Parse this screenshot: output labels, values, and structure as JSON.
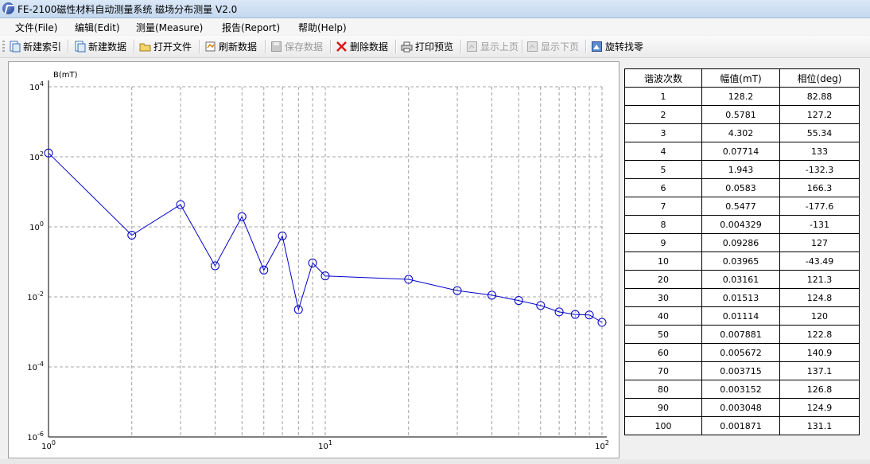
{
  "window": {
    "title": "FE-2100磁性材料自动测量系统 磁场分布测量 V2.0"
  },
  "menu": [
    "文件(File)",
    "编辑(Edit)",
    "测量(Measure)",
    "报告(Report)",
    "帮助(Help)"
  ],
  "toolbar": [
    {
      "label": "新建索引",
      "icon": "new-index-icon",
      "enabled": true
    },
    {
      "label": "新建数据",
      "icon": "new-data-icon",
      "enabled": true
    },
    {
      "label": "打开文件",
      "icon": "open-folder-icon",
      "enabled": true
    },
    {
      "label": "刷新数据",
      "icon": "refresh-icon",
      "enabled": true
    },
    {
      "label": "保存数据",
      "icon": "save-disk-icon",
      "enabled": false
    },
    {
      "label": "删除数据",
      "icon": "delete-x-icon",
      "enabled": true
    },
    {
      "label": "打印预览",
      "icon": "print-preview-icon",
      "enabled": true
    },
    {
      "label": "显示上页",
      "icon": "prev-page-icon",
      "enabled": false
    },
    {
      "label": "显示下页",
      "icon": "next-page-icon",
      "enabled": false
    },
    {
      "label": "旋转找零",
      "icon": "rotate-zero-icon",
      "enabled": true
    }
  ],
  "chart_data": {
    "type": "line",
    "ylabel": "B(mT)",
    "xscale": "log",
    "yscale": "log",
    "xlim": [
      1,
      100
    ],
    "ylim": [
      1e-06,
      10000
    ],
    "x_ticks": [
      "10^0",
      "10^1",
      "10^2"
    ],
    "y_ticks": [
      "10^4",
      "10^2",
      "10^0",
      "10^-2",
      "10^-4",
      "10^-6"
    ],
    "grid": true,
    "marker": "circle",
    "color": "#0000cc",
    "x": [
      1,
      2,
      3,
      4,
      5,
      6,
      7,
      8,
      9,
      10,
      20,
      30,
      40,
      50,
      60,
      70,
      80,
      90,
      100
    ],
    "values": [
      128.2,
      0.5781,
      4.302,
      0.07714,
      1.943,
      0.0583,
      0.5477,
      0.004329,
      0.09286,
      0.03965,
      0.03161,
      0.01513,
      0.01114,
      0.007881,
      0.005672,
      0.003715,
      0.003152,
      0.003048,
      0.001871
    ]
  },
  "table": {
    "headers": [
      "谐波次数",
      "幅值(mT)",
      "相位(deg)"
    ],
    "rows": [
      [
        "1",
        "128.2",
        "82.88"
      ],
      [
        "2",
        "0.5781",
        "127.2"
      ],
      [
        "3",
        "4.302",
        "55.34"
      ],
      [
        "4",
        "0.07714",
        "133"
      ],
      [
        "5",
        "1.943",
        "-132.3"
      ],
      [
        "6",
        "0.0583",
        "166.3"
      ],
      [
        "7",
        "0.5477",
        "-177.6"
      ],
      [
        "8",
        "0.004329",
        "-131"
      ],
      [
        "9",
        "0.09286",
        "127"
      ],
      [
        "10",
        "0.03965",
        "-43.49"
      ],
      [
        "20",
        "0.03161",
        "121.3"
      ],
      [
        "30",
        "0.01513",
        "124.8"
      ],
      [
        "40",
        "0.01114",
        "120"
      ],
      [
        "50",
        "0.007881",
        "122.8"
      ],
      [
        "60",
        "0.005672",
        "140.9"
      ],
      [
        "70",
        "0.003715",
        "137.1"
      ],
      [
        "80",
        "0.003152",
        "126.8"
      ],
      [
        "90",
        "0.003048",
        "124.9"
      ],
      [
        "100",
        "0.001871",
        "131.1"
      ]
    ]
  }
}
